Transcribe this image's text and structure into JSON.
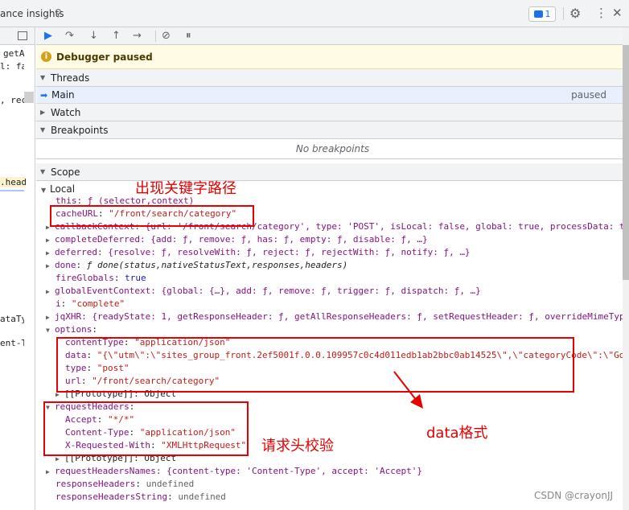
{
  "topbar": {
    "tab_title": "ance insights",
    "issues_count": "1",
    "icons": [
      "pin-icon",
      "issues-icon",
      "gear-icon",
      "more-icon",
      "close-icon"
    ]
  },
  "left_fragments": [
    {
      "text": "getA",
      "color": "#202124"
    },
    {
      "text": "l: fa",
      "color": "#202124"
    },
    {
      "text": ", rec",
      "color": "#202124"
    },
    {
      "text": ".head",
      "color": "#202124"
    },
    {
      "text": "ataTy",
      "color": "#202124"
    },
    {
      "text": "ent-T",
      "color": "#202124"
    }
  ],
  "debugger": {
    "paused_text": "Debugger paused",
    "threads_label": "Threads",
    "main_thread": "Main",
    "main_status": "paused",
    "watch_label": "Watch",
    "breakpoints_label": "Breakpoints",
    "no_breakpoints": "No breakpoints",
    "scope_label": "Scope",
    "local_label": "Local"
  },
  "scope": {
    "this_line": "this: ƒ (selector,context)",
    "cacheURL_key": "cacheURL",
    "cacheURL_val": "\"/front/search/category\"",
    "callbackContext": "callbackContext: {url: '/front/search/category', type: 'POST', isLocal: false, global: true, processData: t",
    "completeDeferred": "completeDeferred: {add: ƒ, remove: ƒ, has: ƒ, empty: ƒ, disable: ƒ, …}",
    "deferred": "deferred: {resolve: ƒ, resolveWith: ƒ, reject: ƒ, rejectWith: ƒ, notify: ƒ, …}",
    "done_key": "done",
    "done_val": "ƒ done(status,nativeStatusText,responses,headers)",
    "fireGlobals_key": "fireGlobals",
    "fireGlobals_val": "true",
    "globalEventContext": "globalEventContext: {global: {…}, add: ƒ, remove: ƒ, trigger: ƒ, dispatch: ƒ, …}",
    "i_key": "i",
    "i_val": "\"complete\"",
    "jqXHR": "jqXHR: {readyState: 1, getResponseHeader: ƒ, getAllResponseHeaders: ƒ, setRequestHeader: ƒ, overrideMimeTyp",
    "options_key": "options",
    "contentType_key": "contentType",
    "contentType_val": "\"application/json\"",
    "data_key": "data",
    "data_val": "\"{\\\"utm\\\":\\\"sites_group_front.2ef5001f.0.0.109957c0c4d011edb1ab2bbc0ab14525\\\",\\\"categoryCode\\\":\\\"Go",
    "type_key": "type",
    "type_val": "\"post\"",
    "url_key": "url",
    "url_val": "\"/front/search/category\"",
    "prototype1": "[[Prototype]]: Object",
    "requestHeaders_key": "requestHeaders",
    "accept_key": "Accept",
    "accept_val": "\"*/*\"",
    "rh_contentType_key": "Content-Type",
    "rh_contentType_val": "\"application/json\"",
    "xrw_key": "X-Requested-With",
    "xrw_val": "\"XMLHttpRequest\"",
    "prototype2": "[[Prototype]]: Object",
    "requestHeadersNames": "requestHeadersNames: {content-type: 'Content-Type', accept: 'Accept'}",
    "responseHeaders_key": "responseHeaders",
    "responseHeaders_val": "undefined",
    "responseHeadersString_key": "responseHeadersString",
    "responseHeadersString_val": "undefined"
  },
  "annotations": {
    "keyword_path": "出现关键字路径",
    "data_format": "data格式",
    "header_check": "请求头校验",
    "color": "#e60000"
  },
  "watermark": "CSDN @crayonJJ"
}
